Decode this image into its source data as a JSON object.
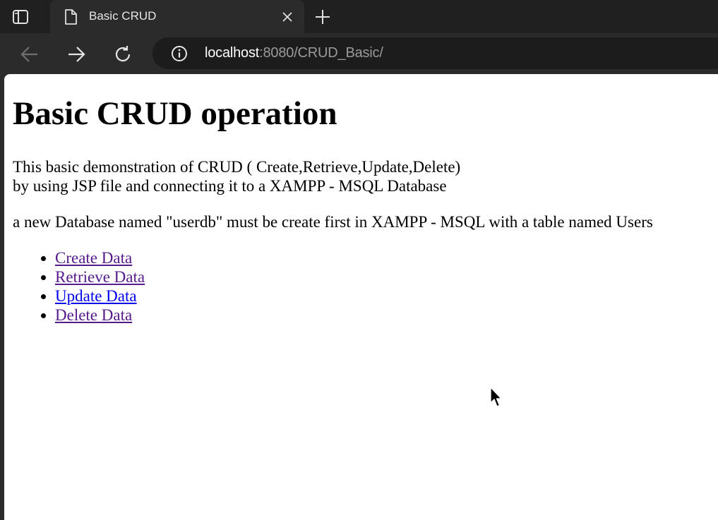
{
  "tab": {
    "title": "Basic CRUD"
  },
  "address": {
    "host": "localhost",
    "rest": ":8080/CRUD_Basic/"
  },
  "page": {
    "title": "Basic CRUD operation",
    "intro_line1": "This basic demonstration of CRUD ( Create,Retrieve,Update,Delete)",
    "intro_line2": "by using JSP file and connecting it to a XAMPP - MSQL Database",
    "note": "a new Database named \"userdb\" must be create first in XAMPP - MSQL with a table named Users",
    "links": [
      {
        "label": "Create Data",
        "visited": true
      },
      {
        "label": "Retrieve Data",
        "visited": true
      },
      {
        "label": "Update Data",
        "visited": false
      },
      {
        "label": "Delete Data",
        "visited": true
      }
    ]
  },
  "colors": {
    "visited_link": "#551a8b",
    "unvisited_link": "#0000ee",
    "chrome_dark": "#202020",
    "toolbar": "#2b2b2b"
  },
  "icons": [
    "tab-actions-icon",
    "page-icon",
    "close-icon",
    "plus-icon",
    "arrow-left-icon",
    "arrow-right-icon",
    "refresh-icon",
    "info-icon",
    "mouse-cursor-icon"
  ]
}
